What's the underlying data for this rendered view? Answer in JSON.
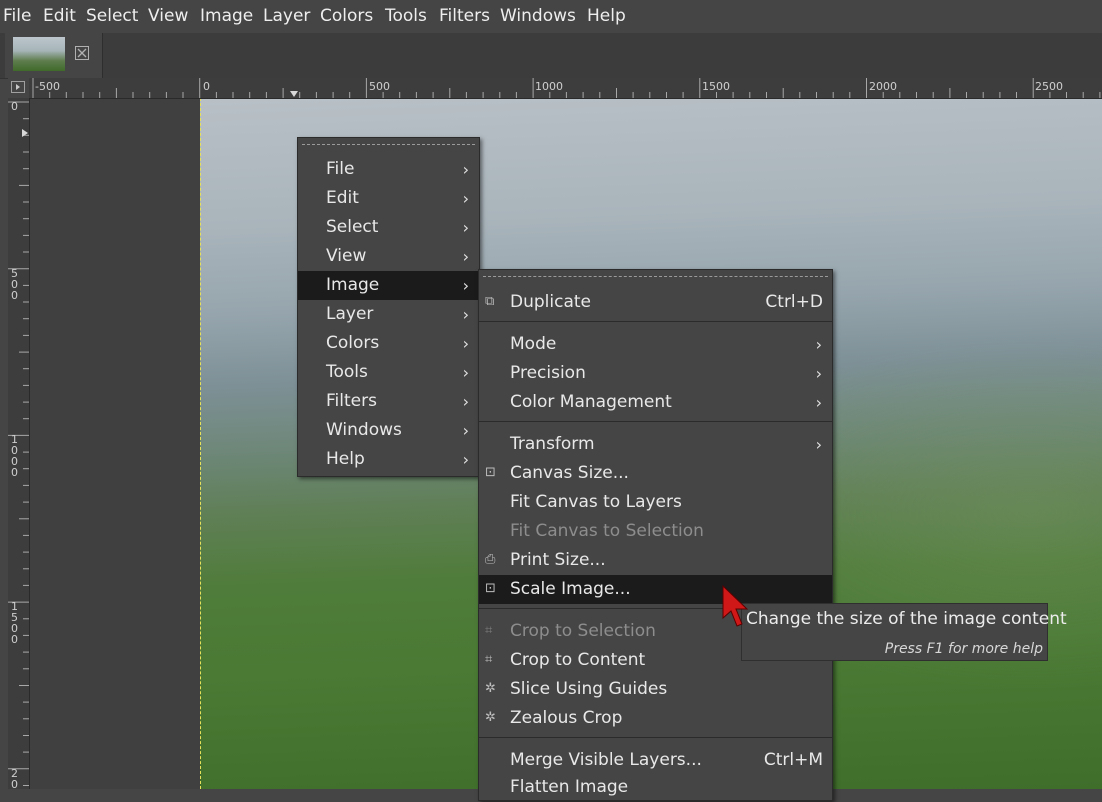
{
  "menubar": {
    "items": [
      "File",
      "Edit",
      "Select",
      "View",
      "Image",
      "Layer",
      "Colors",
      "Tools",
      "Filters",
      "Windows",
      "Help"
    ]
  },
  "tab": {
    "icon": "close-icon"
  },
  "hruler": {
    "labels": [
      "-500",
      "0",
      "500",
      "1000",
      "1500",
      "2000",
      "2500"
    ]
  },
  "vruler": {
    "labels": [
      "0",
      "5\n0\n0",
      "1\n0\n0\n0",
      "1\n5\n0\n0",
      "2\n0"
    ]
  },
  "context_menu": {
    "items": [
      {
        "label": "File"
      },
      {
        "label": "Edit"
      },
      {
        "label": "Select"
      },
      {
        "label": "View"
      },
      {
        "label": "Image"
      },
      {
        "label": "Layer"
      },
      {
        "label": "Colors"
      },
      {
        "label": "Tools"
      },
      {
        "label": "Filters"
      },
      {
        "label": "Windows"
      },
      {
        "label": "Help"
      }
    ]
  },
  "image_menu": {
    "duplicate": {
      "label": "Duplicate",
      "shortcut": "Ctrl+D"
    },
    "mode": "Mode",
    "precision": "Precision",
    "color_management": "Color Management",
    "transform": "Transform",
    "canvas_size": "Canvas Size...",
    "fit_canvas_layers": "Fit Canvas to Layers",
    "fit_canvas_selection": "Fit Canvas to Selection",
    "print_size": "Print Size...",
    "scale_image": "Scale Image...",
    "crop_selection": "Crop to Selection",
    "crop_content": "Crop to Content",
    "slice_guides": "Slice Using Guides",
    "zealous_crop": "Zealous Crop",
    "merge_visible": {
      "label": "Merge Visible Layers...",
      "shortcut": "Ctrl+M"
    },
    "flatten": "Flatten Image"
  },
  "tooltip": {
    "text": "Change the size of the image content",
    "help": "Press F1 for more help"
  },
  "colors": {
    "selection_bg": "#1b1b1b",
    "menu_bg": "#454545",
    "cursor": "#d01818"
  }
}
